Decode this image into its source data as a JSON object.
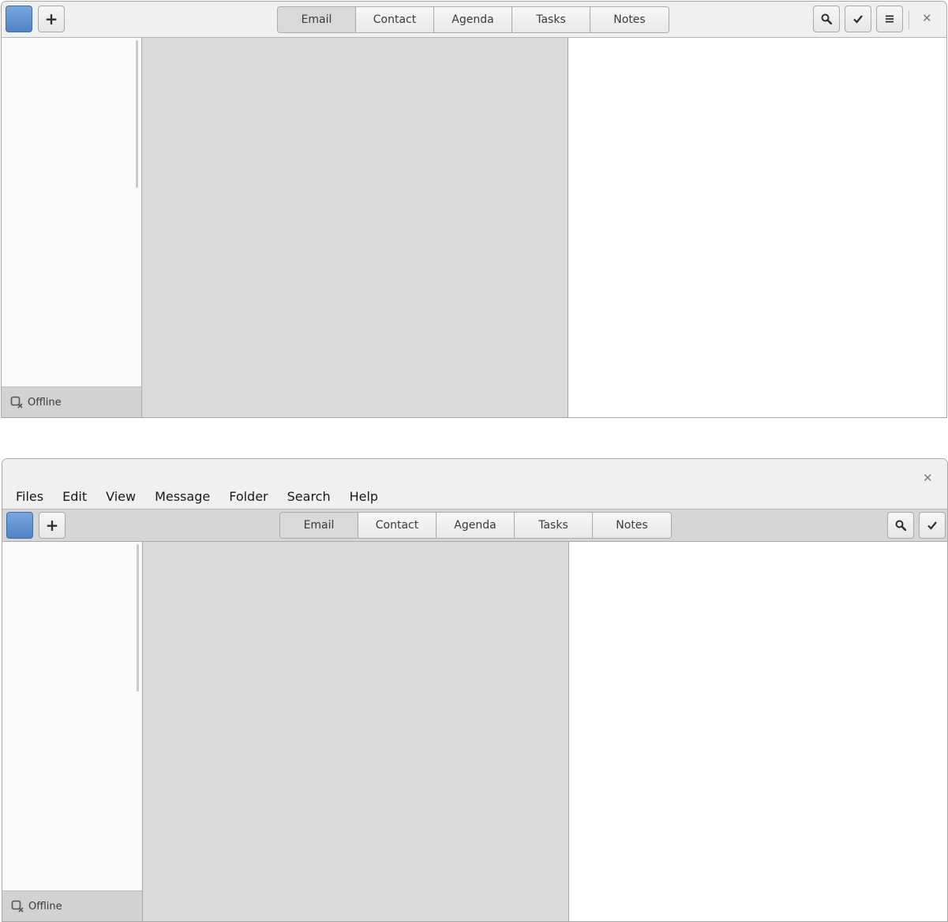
{
  "window1": {
    "tabs": [
      {
        "label": "Email",
        "active": true
      },
      {
        "label": "Contact",
        "active": false
      },
      {
        "label": "Agenda",
        "active": false
      },
      {
        "label": "Tasks",
        "active": false
      },
      {
        "label": "Notes",
        "active": false
      }
    ],
    "new_button_glyph": "+",
    "close_glyph": "✕",
    "status_text": "Offline",
    "icons": [
      "account-icon",
      "plus-icon",
      "search-icon",
      "checkmark-icon",
      "hamburger-menu-icon",
      "close-icon",
      "offline-icon"
    ]
  },
  "window2": {
    "menu": [
      "Files",
      "Edit",
      "View",
      "Message",
      "Folder",
      "Search",
      "Help"
    ],
    "tabs": [
      {
        "label": "Email",
        "active": true
      },
      {
        "label": "Contact",
        "active": false
      },
      {
        "label": "Agenda",
        "active": false
      },
      {
        "label": "Tasks",
        "active": false
      },
      {
        "label": "Notes",
        "active": false
      }
    ],
    "new_button_glyph": "+",
    "close_glyph": "✕",
    "status_text": "Offline",
    "icons": [
      "account-icon",
      "plus-icon",
      "search-icon",
      "checkmark-icon",
      "close-icon",
      "offline-icon"
    ]
  },
  "colors": {
    "accent_blue": "#4f83c6",
    "headerbar": "#f0f0f0",
    "toolbar": "#d6d6d6",
    "list_pane": "#dadada",
    "sidebar": "#fafafa",
    "statusbar": "#d2d2d2"
  }
}
